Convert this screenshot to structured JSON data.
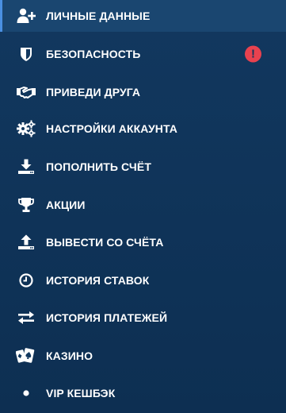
{
  "menu": {
    "items": [
      {
        "label": "ЛИЧНЫЕ ДАННЫЕ",
        "icon": "add-user-icon",
        "active": true
      },
      {
        "label": "БЕЗОПАСНОСТЬ",
        "icon": "shield-icon",
        "alert": "!"
      },
      {
        "label": "ПРИВЕДИ ДРУГА",
        "icon": "handshake-icon"
      },
      {
        "label": "НАСТРОЙКИ АККАУНТА",
        "icon": "gears-icon"
      },
      {
        "label": "ПОПОЛНИТЬ СЧЁТ",
        "icon": "download-tray-icon"
      },
      {
        "label": "АКЦИИ",
        "icon": "trophy-icon"
      },
      {
        "label": "ВЫВЕСТИ СО СЧЁТА",
        "icon": "upload-tray-icon"
      },
      {
        "label": "ИСТОРИЯ СТАВОК",
        "icon": "clock-icon"
      },
      {
        "label": "ИСТОРИЯ ПЛАТЕЖЕЙ",
        "icon": "exchange-arrows-icon"
      },
      {
        "label": "КАЗИНО",
        "icon": "playing-cards-icon"
      },
      {
        "label": "VIP КЕШБЭК",
        "icon": "bullet-dot-icon"
      }
    ]
  },
  "colors": {
    "background": "#12365c",
    "active_background": "#1a4670",
    "active_indicator": "#4a90e2",
    "alert": "#e8424f",
    "text": "#ffffff"
  }
}
